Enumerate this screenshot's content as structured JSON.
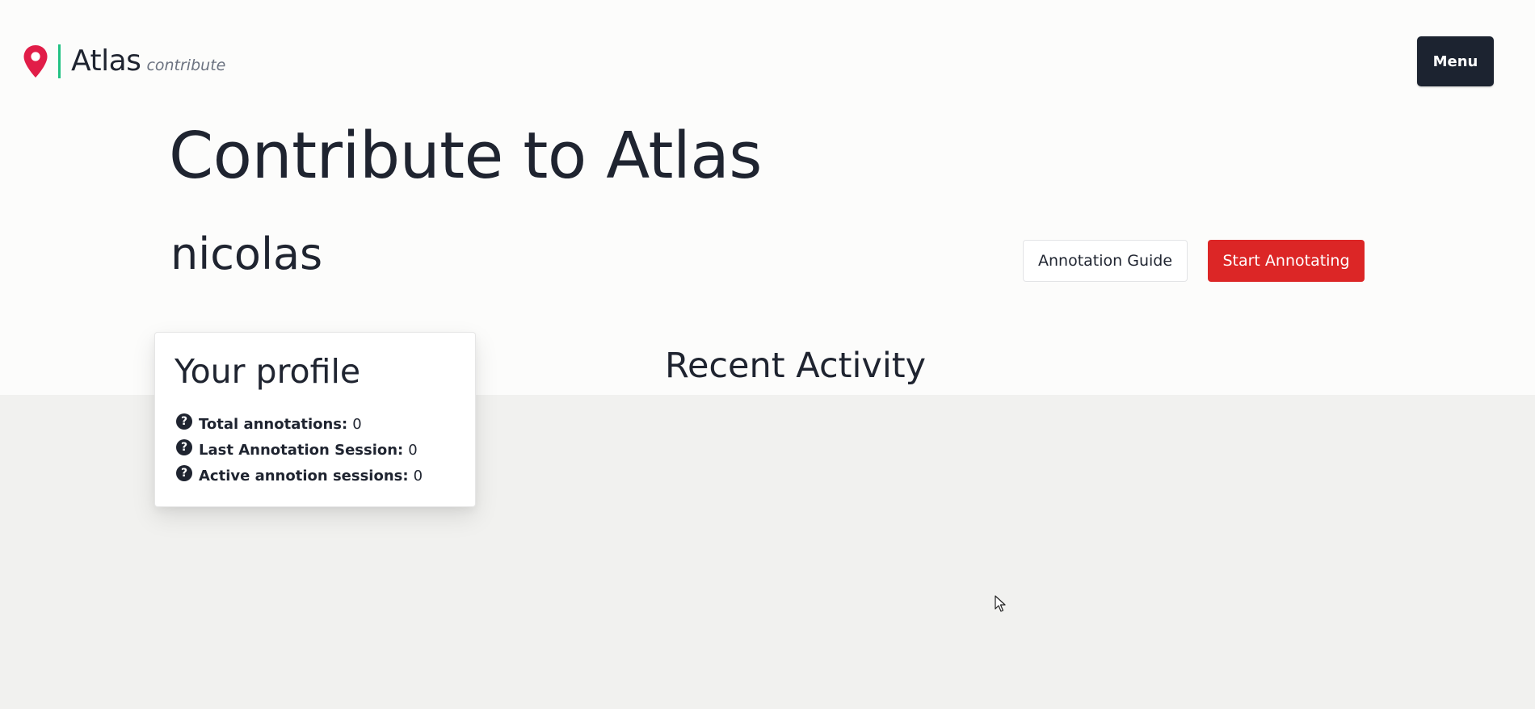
{
  "header": {
    "brand_name": "Atlas",
    "brand_sub": "contribute",
    "menu_label": "Menu"
  },
  "hero": {
    "title": "Contribute to Atlas",
    "username": "nicolas",
    "guide_label": "Annotation Guide",
    "start_label": "Start Annotating"
  },
  "profile": {
    "title": "Your profile",
    "stats": [
      {
        "label": "Total annotations:",
        "value": "0"
      },
      {
        "label": "Last Annotation Session:",
        "value": "0"
      },
      {
        "label": "Active annotion sessions:",
        "value": "0"
      }
    ]
  },
  "activity": {
    "title": "Recent Activity"
  },
  "icons": {
    "brand": "map-pin-icon",
    "help": "question-circle-icon",
    "cursor": "mouse-pointer-icon"
  },
  "colors": {
    "accent": "#e11d48",
    "divider": "#22c283",
    "menu_bg": "#1c2330",
    "primary_button": "#dc2626"
  }
}
